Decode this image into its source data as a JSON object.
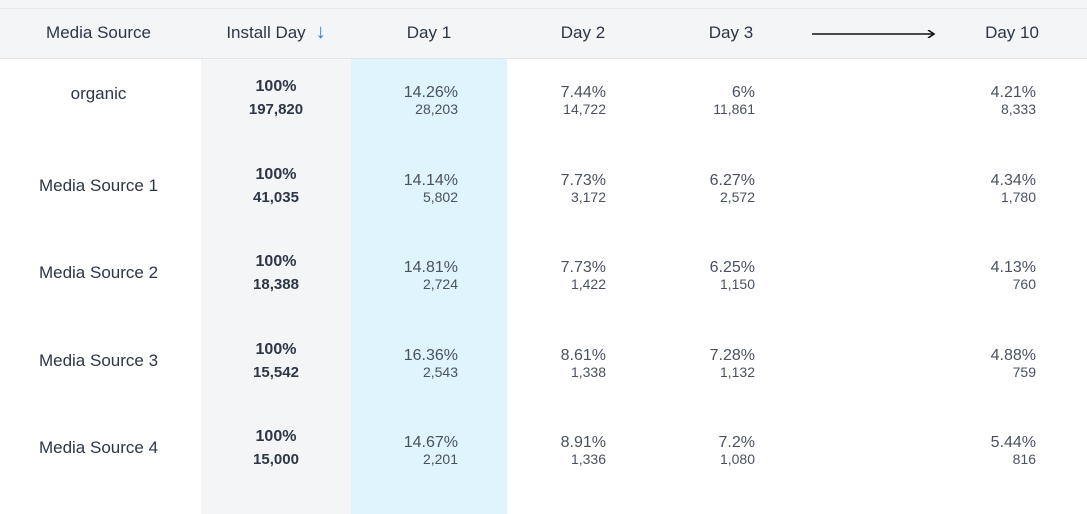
{
  "header": {
    "media_source": "Media Source",
    "install_day": "Install Day",
    "sort_icon": "arrow-down",
    "day1": "Day 1",
    "day2": "Day 2",
    "day3": "Day 3",
    "day10": "Day 10"
  },
  "colors": {
    "sort_accent": "#1e7fd6",
    "install_column_bg": "#f4f5f7",
    "day1_highlight_bg": "#dff4fc"
  },
  "rows": [
    {
      "source": "organic",
      "install_pct": "100%",
      "install_count": "197,820",
      "day1_pct": "14.26%",
      "day1_count": "28,203",
      "day2_pct": "7.44%",
      "day2_count": "14,722",
      "day3_pct": "6%",
      "day3_count": "11,861",
      "day10_pct": "4.21%",
      "day10_count": "8,333"
    },
    {
      "source": "Media Source 1",
      "install_pct": "100%",
      "install_count": "41,035",
      "day1_pct": "14.14%",
      "day1_count": "5,802",
      "day2_pct": "7.73%",
      "day2_count": "3,172",
      "day3_pct": "6.27%",
      "day3_count": "2,572",
      "day10_pct": "4.34%",
      "day10_count": "1,780"
    },
    {
      "source": "Media Source 2",
      "install_pct": "100%",
      "install_count": "18,388",
      "day1_pct": "14.81%",
      "day1_count": "2,724",
      "day2_pct": "7.73%",
      "day2_count": "1,422",
      "day3_pct": "6.25%",
      "day3_count": "1,150",
      "day10_pct": "4.13%",
      "day10_count": "760"
    },
    {
      "source": "Media Source 3",
      "install_pct": "100%",
      "install_count": "15,542",
      "day1_pct": "16.36%",
      "day1_count": "2,543",
      "day2_pct": "8.61%",
      "day2_count": "1,338",
      "day3_pct": "7.28%",
      "day3_count": "1,132",
      "day10_pct": "4.88%",
      "day10_count": "759"
    },
    {
      "source": "Media Source 4",
      "install_pct": "100%",
      "install_count": "15,000",
      "day1_pct": "14.67%",
      "day1_count": "2,201",
      "day2_pct": "8.91%",
      "day2_count": "1,336",
      "day3_pct": "7.2%",
      "day3_count": "1,080",
      "day10_pct": "5.44%",
      "day10_count": "816"
    }
  ]
}
